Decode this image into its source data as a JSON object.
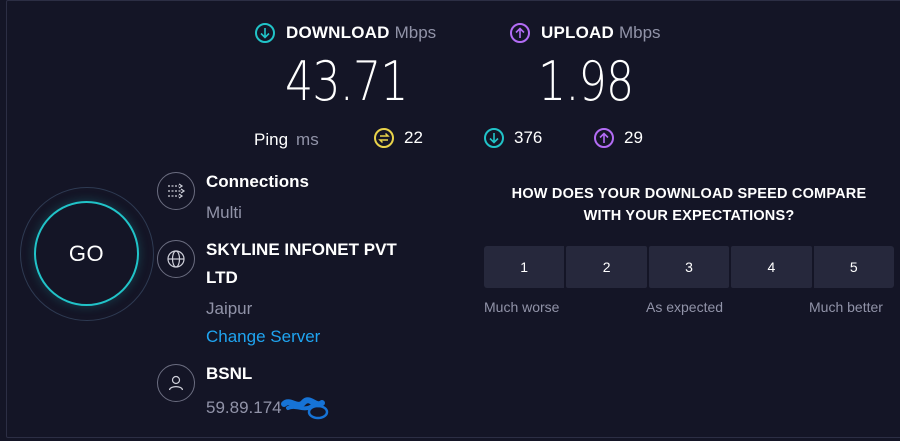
{
  "download": {
    "label": "DOWNLOAD",
    "unit": "Mbps",
    "value": "43.71",
    "icon": "arrow-down-circle-icon",
    "color": "#21c3c8"
  },
  "upload": {
    "label": "UPLOAD",
    "unit": "Mbps",
    "value": "1.98",
    "icon": "arrow-up-circle-icon",
    "color": "#b36cf5"
  },
  "ping": {
    "label": "Ping",
    "unit": "ms",
    "idle": {
      "value": "22",
      "icon": "exchange-circle-icon",
      "color": "#e9d34a"
    },
    "download": {
      "value": "376",
      "icon": "arrow-down-circle-icon",
      "color": "#21c3c8"
    },
    "upload": {
      "value": "29",
      "icon": "arrow-up-circle-icon",
      "color": "#b36cf5"
    }
  },
  "go": {
    "label": "GO"
  },
  "connections": {
    "title": "Connections",
    "value": "Multi",
    "icon": "connections-icon"
  },
  "server": {
    "name_line1": "SKYLINE INFONET PVT",
    "name_line2": "LTD",
    "location": "Jaipur",
    "change_label": "Change Server",
    "icon": "globe-icon"
  },
  "provider": {
    "name": "BSNL",
    "ip": "59.89.174",
    "icon": "user-icon"
  },
  "survey": {
    "question_line1": "HOW DOES YOUR DOWNLOAD SPEED COMPARE",
    "question_line2": "WITH YOUR EXPECTATIONS?",
    "ratings": [
      "1",
      "2",
      "3",
      "4",
      "5"
    ],
    "scale": {
      "low": "Much worse",
      "mid": "As expected",
      "high": "Much better"
    }
  }
}
